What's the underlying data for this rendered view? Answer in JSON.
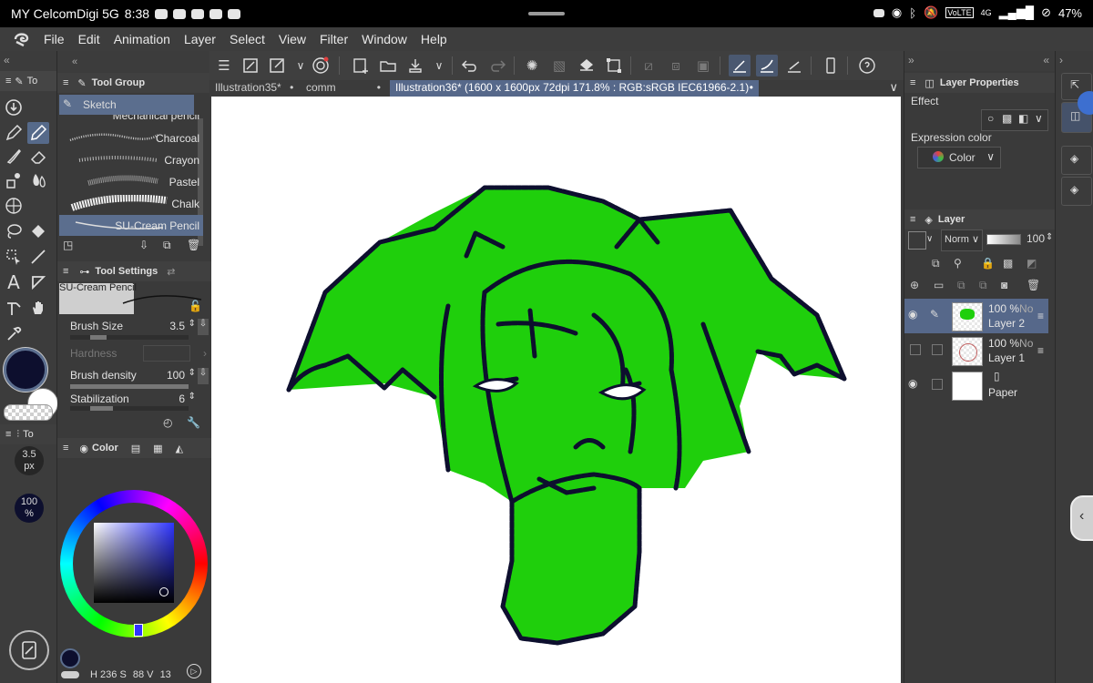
{
  "status": {
    "carrier": "MY CelcomDigi 5G",
    "time": "8:38",
    "battery": "47%",
    "volte": "VoLTE",
    "net": "4G"
  },
  "menu": [
    "File",
    "Edit",
    "Animation",
    "Layer",
    "Select",
    "View",
    "Filter",
    "Window",
    "Help"
  ],
  "tabs": [
    {
      "label": "Illustration35*"
    },
    {
      "label": "comm"
    },
    {
      "label": "Illustration36* (1600 x 1600px 72dpi 171.8% : RGB:sRGB IEC61966-2.1)"
    }
  ],
  "left_panel": {
    "tool_tab_label": "To",
    "tool_group_title": "Tool Group",
    "sub_tool_selected": "Sketch",
    "brushes": [
      "Mechanical pencil",
      "Charcoal",
      "Crayon",
      "Pastel",
      "Chalk",
      "SU-Cream Pencil"
    ],
    "tool_settings_title": "Tool Settings",
    "current_brush": "SU-Cream Pencil",
    "settings": [
      {
        "label": "Brush Size",
        "value": "3.5"
      },
      {
        "label": "Hardness",
        "value": ""
      },
      {
        "label": "Brush density",
        "value": "100"
      },
      {
        "label": "Stabilization",
        "value": "6"
      }
    ],
    "size_readout": "3.5",
    "size_unit": "px",
    "opacity_readout": "100",
    "opacity_unit": "%",
    "strip_tab_label": "To",
    "color_title": "Color",
    "main_color": "#0d0f2e",
    "sub_color": "#ffffff",
    "hsv": {
      "h_label": "H",
      "h": "236",
      "s_label": "S",
      "s": "88",
      "v_label": "V",
      "v": "13"
    }
  },
  "right_panel": {
    "layer_properties_title": "Layer Properties",
    "effect_label": "Effect",
    "expression_color_label": "Expression color",
    "expression_color_value": "Color",
    "layer_title": "Layer",
    "blend_mode": "Norm",
    "opacity": "100",
    "layers": [
      {
        "name": "Layer 2",
        "opacity": "100 %",
        "mode": "No",
        "visible": true,
        "selected": true
      },
      {
        "name": "Layer 1",
        "opacity": "100 %",
        "mode": "No",
        "visible": false,
        "selected": false
      },
      {
        "name": "Paper",
        "opacity": "",
        "mode": "",
        "visible": true,
        "selected": false
      }
    ]
  },
  "colors": {
    "accent_selection": "#56688a",
    "fill_green": "#1fcf0c",
    "outline": "#0d0f2e"
  }
}
